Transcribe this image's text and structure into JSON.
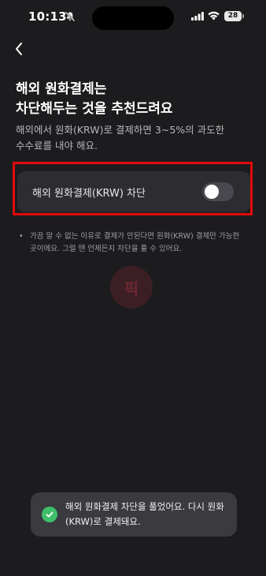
{
  "status_bar": {
    "time": "10:13",
    "battery": "28",
    "icons": [
      "bell-slash-icon",
      "signal-icon",
      "wifi-icon",
      "battery-icon"
    ]
  },
  "nav": {
    "back_icon": "chevron-left-icon"
  },
  "header": {
    "title_line1": "해외 원화결제는",
    "title_line2": "차단해두는 것을 추천드려요",
    "subtitle_line1": "해외에서 원화(KRW)로 결제하면 3~5%의 과도한",
    "subtitle_line2": "수수료를 내야 해요."
  },
  "setting": {
    "label": "해외 원화결제(KRW) 차단",
    "toggle_on": false
  },
  "note": {
    "bullet": "•",
    "text": "가끔 알 수 없는 이유로 결제가 안된다면 원화(KRW) 결제만 가능한 곳이에요. 그럴 땐 언제든지 차단을 풀 수 있어요."
  },
  "watermark": {
    "text": "픽"
  },
  "toast": {
    "icon": "check-circle-icon",
    "text": "해외 원화결제 차단을 풀었어요. 다시 원화(KRW)로 결제돼요."
  },
  "colors": {
    "background": "#1c1c1e",
    "card": "#2d2d31",
    "highlight": "#e10b0b",
    "success": "#3fbf6a",
    "toggle_off": "#48484e"
  }
}
